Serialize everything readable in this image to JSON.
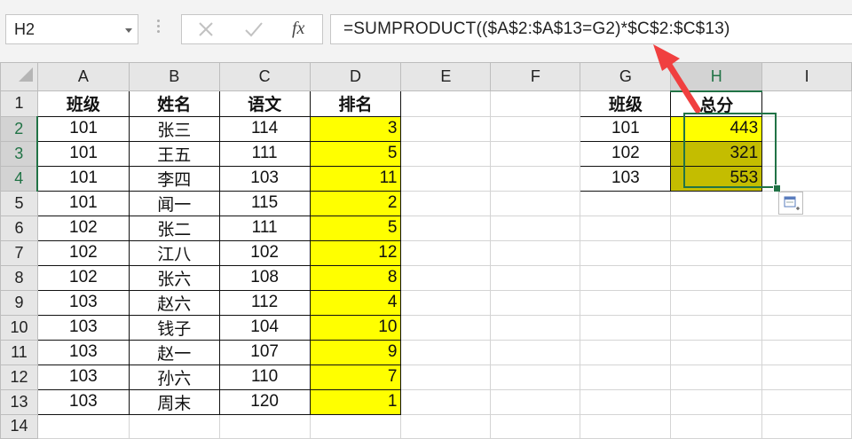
{
  "name_box": {
    "value": "H2"
  },
  "formula_bar": {
    "cancel_icon": "x-icon",
    "enter_icon": "check-icon",
    "function_label": "fx",
    "formula": "=SUMPRODUCT(($A$2:$A$13=G2)*$C$2:$C$13)"
  },
  "columns": [
    "A",
    "B",
    "C",
    "D",
    "E",
    "F",
    "G",
    "H",
    "I"
  ],
  "selected_column": "H",
  "rows": [
    "1",
    "2",
    "3",
    "4",
    "5",
    "6",
    "7",
    "8",
    "9",
    "10",
    "11",
    "12",
    "13",
    "14"
  ],
  "table1": {
    "headers": [
      "班级",
      "姓名",
      "语文",
      "排名"
    ],
    "data": [
      [
        "101",
        "张三",
        "114",
        "3"
      ],
      [
        "101",
        "王五",
        "111",
        "5"
      ],
      [
        "101",
        "李四",
        "103",
        "11"
      ],
      [
        "101",
        "闻一",
        "115",
        "2"
      ],
      [
        "102",
        "张二",
        "111",
        "5"
      ],
      [
        "102",
        "江八",
        "102",
        "12"
      ],
      [
        "102",
        "张六",
        "108",
        "8"
      ],
      [
        "103",
        "赵六",
        "112",
        "4"
      ],
      [
        "103",
        "钱子",
        "104",
        "10"
      ],
      [
        "103",
        "赵一",
        "107",
        "9"
      ],
      [
        "103",
        "孙六",
        "110",
        "7"
      ],
      [
        "103",
        "周末",
        "120",
        "1"
      ]
    ]
  },
  "table2": {
    "headers": [
      "班级",
      "总分"
    ],
    "data": [
      [
        "101",
        "443"
      ],
      [
        "102",
        "321"
      ],
      [
        "103",
        "553"
      ]
    ]
  },
  "colors": {
    "highlight_yellow": "#ffff00",
    "selected_fill": "#c4bd00",
    "selection_green": "#217346",
    "arrow_red": "#f04040"
  },
  "paste_options_icon": "paste-options-icon"
}
